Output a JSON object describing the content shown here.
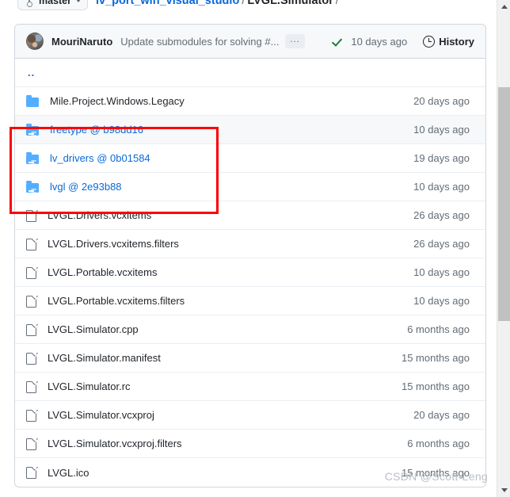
{
  "breadcrumb": {
    "branch_label": "master",
    "path_parts": [
      "lv_port_win_visual_studio",
      "LVGL.Simulator"
    ],
    "separator": "/"
  },
  "commit_bar": {
    "author": "MouriNaruto",
    "message": "Update submodules for solving #...",
    "ellipsis_label": "...",
    "status_icon": "check-icon",
    "time": "10 days ago",
    "history_label": "History",
    "history_icon": "clock-icon"
  },
  "files": {
    "parent_row": {
      "name": "..",
      "icon": "parent-directory",
      "time": ""
    },
    "rows": [
      {
        "name": "Mile.Project.Windows.Legacy",
        "icon": "folder-icon",
        "type": "folder",
        "time": "20 days ago",
        "highlighted": false
      },
      {
        "name": "freetype @ b98dd16",
        "icon": "submodule-icon",
        "type": "submodule",
        "time": "10 days ago",
        "highlighted": true
      },
      {
        "name": "lv_drivers @ 0b01584",
        "icon": "submodule-icon",
        "type": "submodule",
        "time": "19 days ago",
        "highlighted": false
      },
      {
        "name": "lvgl @ 2e93b88",
        "icon": "submodule-icon",
        "type": "submodule",
        "time": "10 days ago",
        "highlighted": false
      },
      {
        "name": "LVGL.Drivers.vcxitems",
        "icon": "file-icon",
        "type": "file",
        "time": "26 days ago",
        "highlighted": false
      },
      {
        "name": "LVGL.Drivers.vcxitems.filters",
        "icon": "file-icon",
        "type": "file",
        "time": "26 days ago",
        "highlighted": false
      },
      {
        "name": "LVGL.Portable.vcxitems",
        "icon": "file-icon",
        "type": "file",
        "time": "10 days ago",
        "highlighted": false
      },
      {
        "name": "LVGL.Portable.vcxitems.filters",
        "icon": "file-icon",
        "type": "file",
        "time": "10 days ago",
        "highlighted": false
      },
      {
        "name": "LVGL.Simulator.cpp",
        "icon": "file-icon",
        "type": "file",
        "time": "6 months ago",
        "highlighted": false
      },
      {
        "name": "LVGL.Simulator.manifest",
        "icon": "file-icon",
        "type": "file",
        "time": "15 months ago",
        "highlighted": false
      },
      {
        "name": "LVGL.Simulator.rc",
        "icon": "file-icon",
        "type": "file",
        "time": "15 months ago",
        "highlighted": false
      },
      {
        "name": "LVGL.Simulator.vcxproj",
        "icon": "file-icon",
        "type": "file",
        "time": "20 days ago",
        "highlighted": false
      },
      {
        "name": "LVGL.Simulator.vcxproj.filters",
        "icon": "file-icon",
        "type": "file",
        "time": "6 months ago",
        "highlighted": false
      },
      {
        "name": "LVGL.ico",
        "icon": "file-icon",
        "type": "file",
        "time": "15 months ago",
        "highlighted": false
      }
    ]
  },
  "annotation": {
    "color": "#ff0000",
    "targets": [
      "freetype @ b98dd16",
      "lv_drivers @ 0b01584",
      "lvgl @ 2e93b88"
    ]
  },
  "watermark": {
    "text": "CSDN @Scott-Leng"
  },
  "colors": {
    "link": "#0969da",
    "folder": "#54aeff",
    "muted": "#636c76",
    "border": "#d0d7de",
    "row_hover": "#f6f8fa",
    "check_green": "#1a7f37"
  }
}
